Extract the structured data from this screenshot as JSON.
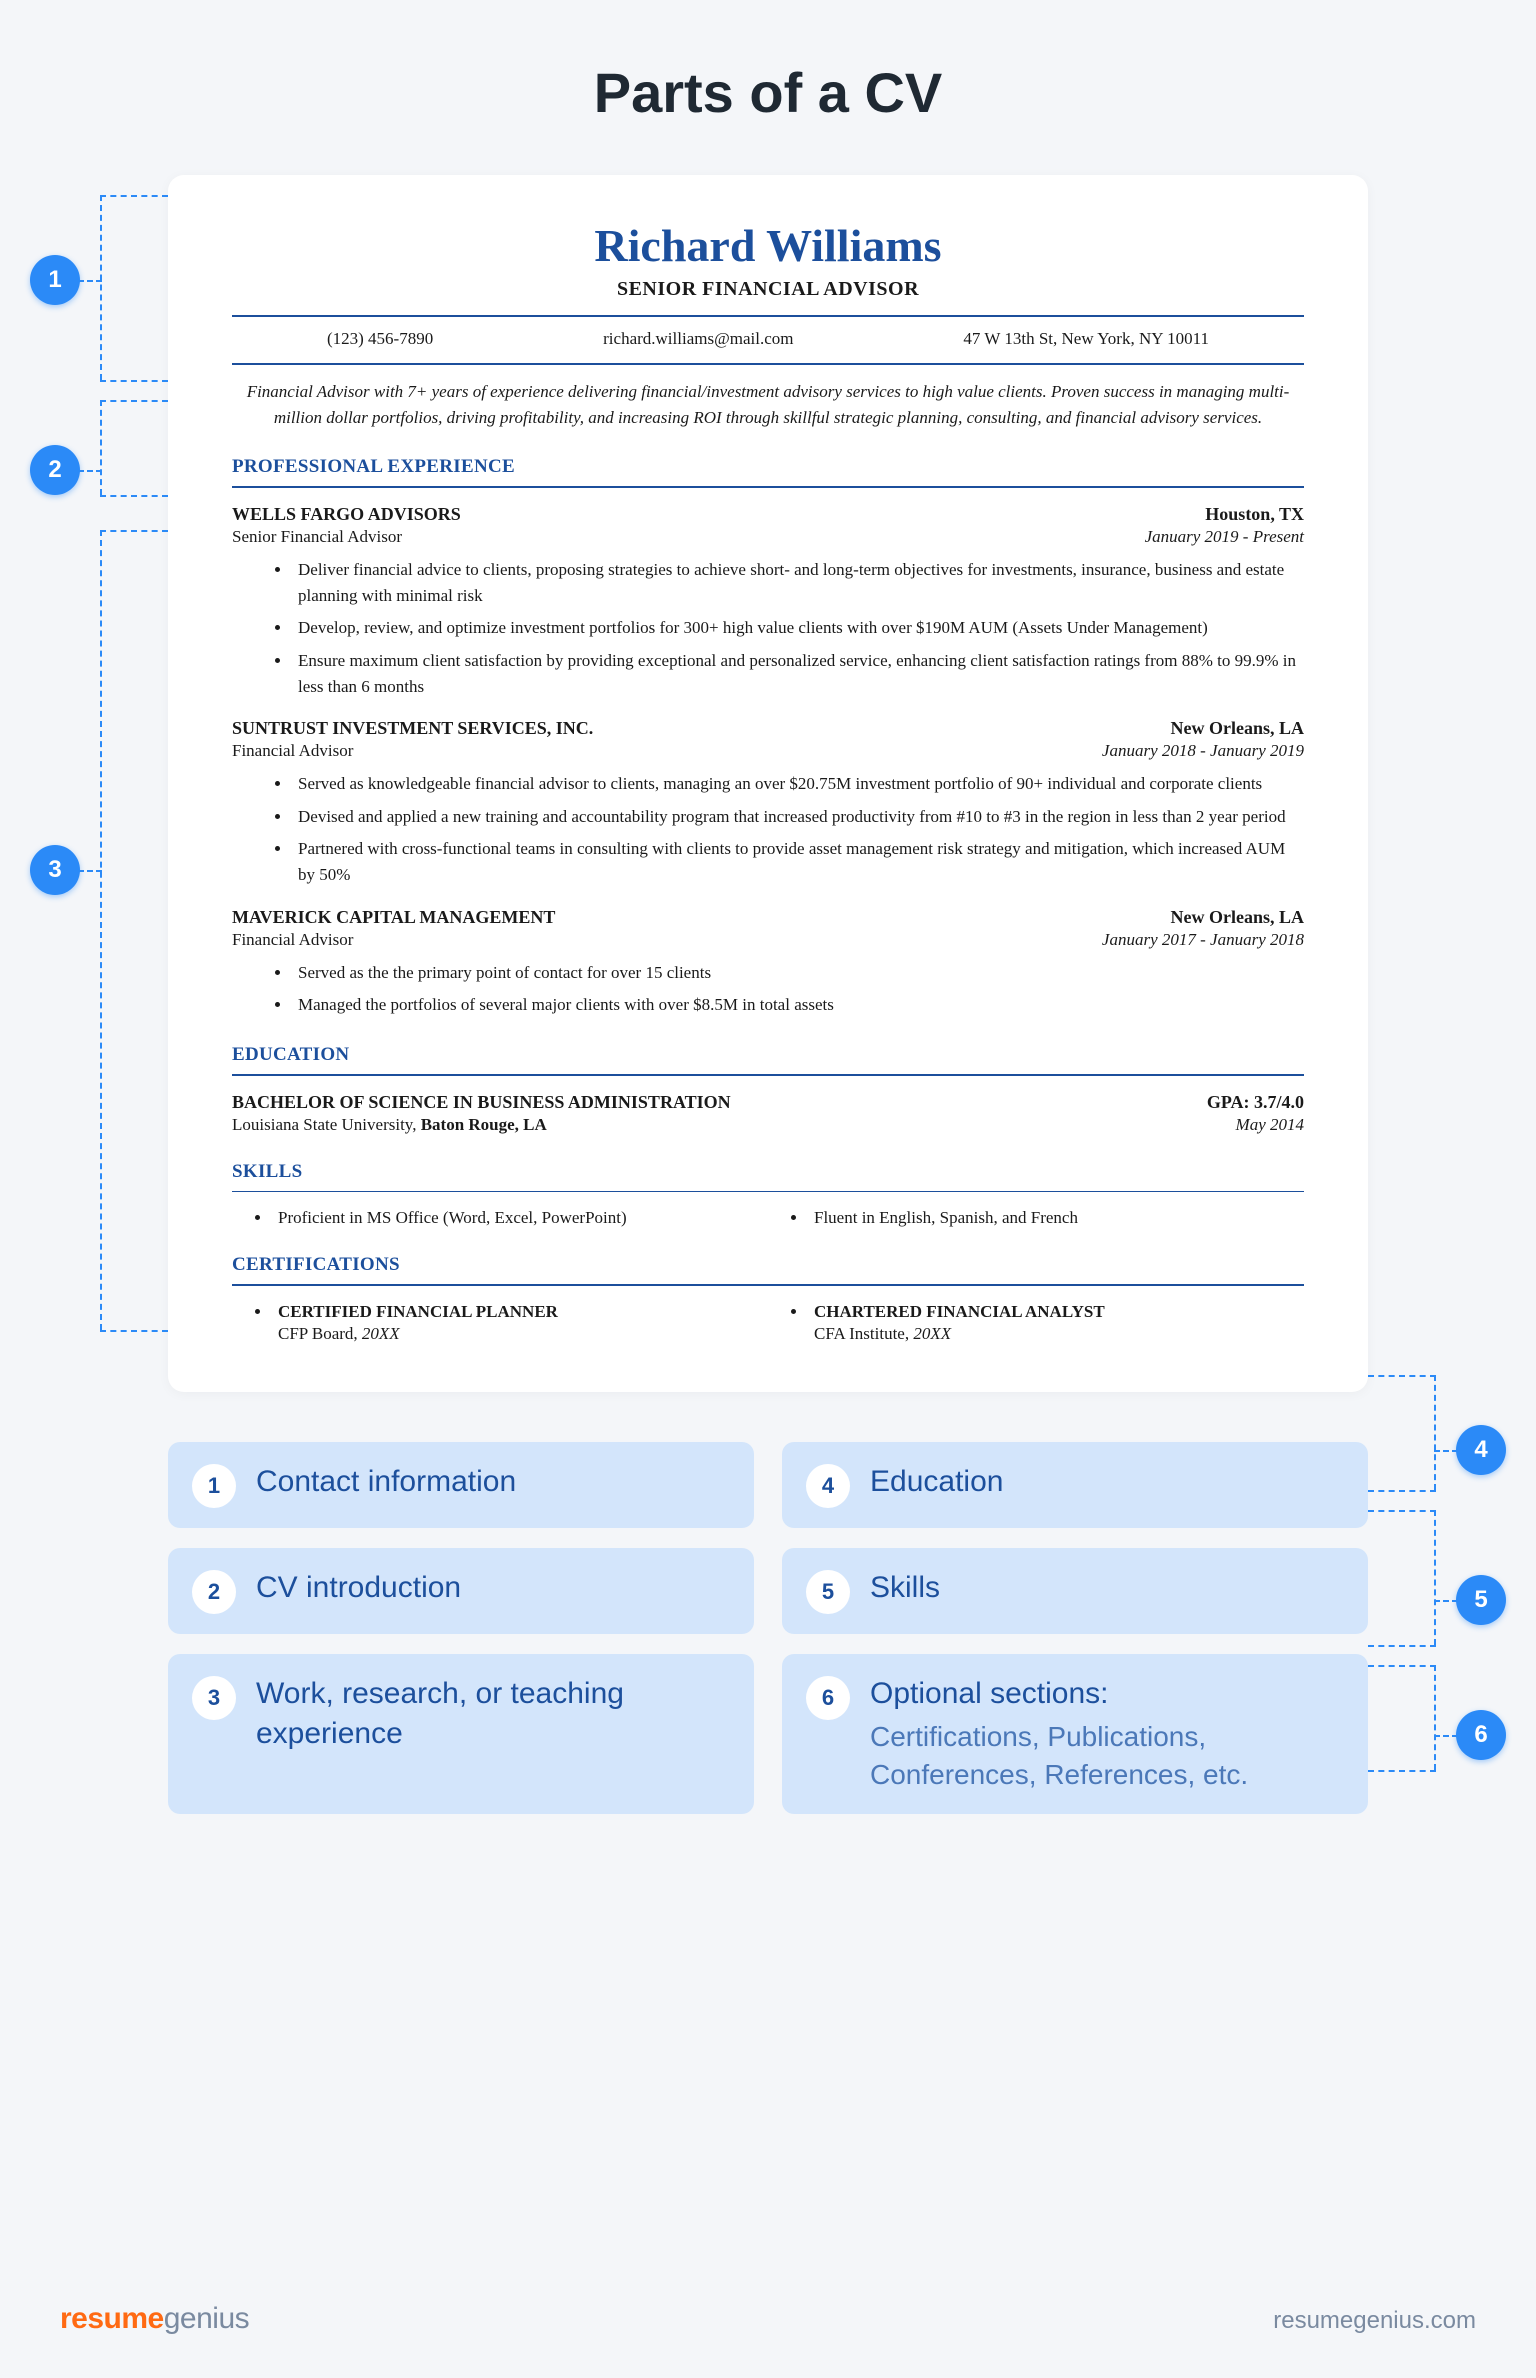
{
  "page_title": "Parts of a CV",
  "cv": {
    "name": "Richard Williams",
    "role": "SENIOR FINANCIAL ADVISOR",
    "contacts": {
      "phone": "(123) 456-7890",
      "email": "richard.williams@mail.com",
      "address": "47 W 13th St, New York, NY 10011"
    },
    "summary": "Financial Advisor with 7+ years of experience delivering financial/investment advisory services to high value clients. Proven success in managing multi-million dollar portfolios, driving profitability, and increasing ROI through skillful strategic planning, consulting, and financial advisory services.",
    "sections": {
      "experience_title": "PROFESSIONAL EXPERIENCE",
      "education_title": "EDUCATION",
      "skills_title": "SKILLS",
      "certs_title": "CERTIFICATIONS"
    },
    "jobs": [
      {
        "company": "WELLS FARGO ADVISORS",
        "location": "Houston, TX",
        "title": "Senior Financial Advisor",
        "dates": "January 2019 - Present",
        "bullets": [
          "Deliver financial advice to clients, proposing strategies to achieve short- and long-term objectives for investments, insurance, business and estate planning with minimal risk",
          "Develop, review, and optimize investment portfolios for 300+ high value clients with over $190M AUM (Assets Under Management)",
          "Ensure maximum client satisfaction by providing exceptional and personalized service, enhancing client satisfaction ratings from 88% to 99.9% in less than 6 months"
        ]
      },
      {
        "company": "SUNTRUST INVESTMENT  SERVICES, INC.",
        "location": "New Orleans, LA",
        "title": "Financial Advisor",
        "dates": "January 2018 - January 2019",
        "bullets": [
          "Served as knowledgeable financial advisor to clients, managing an over $20.75M investment portfolio of 90+ individual and corporate clients",
          "Devised and applied a new training and accountability program that increased productivity from #10 to #3 in the region in less than 2 year period",
          "Partnered with cross-functional teams in consulting with clients to provide asset management risk strategy and mitigation, which increased AUM by 50%"
        ]
      },
      {
        "company": "MAVERICK CAPITAL MANAGEMENT",
        "location": "New Orleans, LA",
        "title": "Financial Advisor",
        "dates": "January 2017 -  January 2018",
        "bullets": [
          "Served as the the primary point of contact for over 15 clients",
          "Managed the portfolios of several major clients with over $8.5M in total assets"
        ]
      }
    ],
    "education": {
      "degree": "BACHELOR OF SCIENCE IN BUSINESS ADMINISTRATION",
      "gpa": "GPA: 3.7/4.0",
      "school_prefix": "Louisiana State University,  ",
      "school_bold": "Baton Rouge, LA",
      "date": "May 2014"
    },
    "skills": [
      "Proficient in MS Office (Word, Excel, PowerPoint)",
      "Fluent in English, Spanish, and French"
    ],
    "certs": [
      {
        "title": "CERTIFIED FINANCIAL PLANNER",
        "issuer": "CFP Board,  ",
        "year": "20XX"
      },
      {
        "title": "CHARTERED FINANCIAL ANALYST",
        "issuer": "CFA Institute,  ",
        "year": "20XX"
      }
    ]
  },
  "callouts": [
    "1",
    "2",
    "3",
    "4",
    "5",
    "6"
  ],
  "legend": [
    {
      "n": "1",
      "t": "Contact information"
    },
    {
      "n": "2",
      "t": "CV introduction"
    },
    {
      "n": "3",
      "t": "Work, research, or teaching experience"
    },
    {
      "n": "4",
      "t": "Education"
    },
    {
      "n": "5",
      "t": "Skills"
    },
    {
      "n": "6",
      "t": "Optional sections:",
      "sub": "Certifications, Publications, Conferences, References, etc."
    }
  ],
  "footer": {
    "brand_a": "resume",
    "brand_b": "genius",
    "site": "resumegenius.com"
  }
}
